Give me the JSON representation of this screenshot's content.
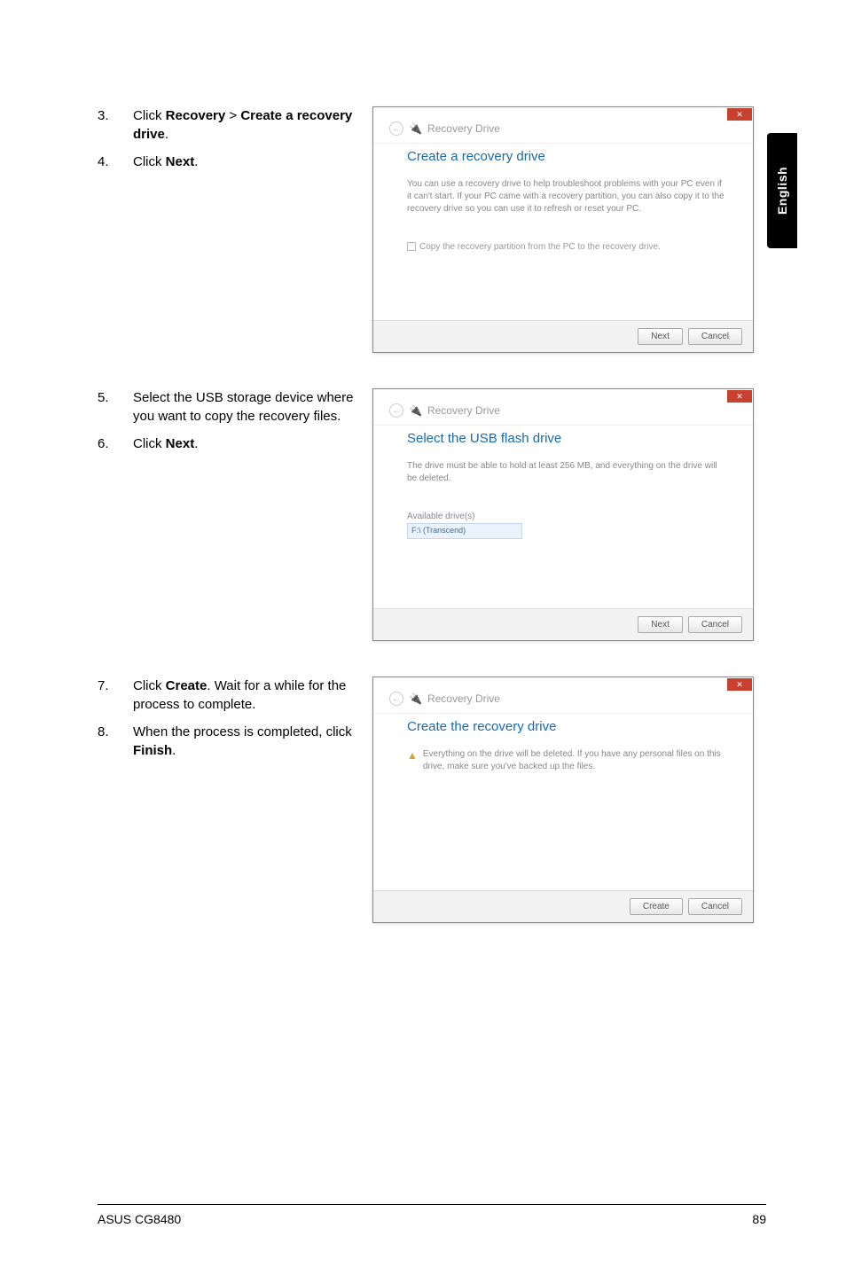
{
  "sideTab": "English",
  "sections": [
    {
      "items": [
        {
          "num": "3.",
          "html": "Click <b>Recovery</b> > <b>Create a recovery drive</b>."
        },
        {
          "num": "4.",
          "html": "Click <b>Next</b>."
        }
      ],
      "dialog": {
        "crumbIcon": "usb-icon",
        "crumbText": "Recovery Drive",
        "title": "Create a recovery drive",
        "desc": "You can use a recovery drive to help troubleshoot problems with your PC even if it can't start. If your PC came with a recovery partition, you can also copy it to the recovery drive so you can use it to refresh or reset your PC.",
        "checkboxLabel": "Copy the recovery partition from the PC to the recovery drive.",
        "buttons": [
          "Next",
          "Cancel"
        ]
      }
    },
    {
      "items": [
        {
          "num": "5.",
          "html": "Select the USB storage device where you want to copy the recovery files."
        },
        {
          "num": "6.",
          "html": "Click <b>Next</b>."
        }
      ],
      "dialog": {
        "crumbIcon": "usb-icon",
        "crumbText": "Recovery Drive",
        "title": "Select the USB flash drive",
        "desc": "The drive must be able to hold at least 256 MB, and everything on the drive will be deleted.",
        "listLabel": "Available drive(s)",
        "listItem": "F:\\ (Transcend)",
        "buttons": [
          "Next",
          "Cancel"
        ]
      }
    },
    {
      "items": [
        {
          "num": "7.",
          "html": "Click <b>Create</b>. Wait for a while for the process to complete."
        },
        {
          "num": "8.",
          "html": "When the process is completed, click <b>Finish</b>."
        }
      ],
      "dialog": {
        "crumbIcon": "usb-icon",
        "crumbText": "Recovery Drive",
        "title": "Create the recovery drive",
        "warn": "Everything on the drive will be deleted. If you have any personal files on this drive, make sure you've backed up the files.",
        "buttons": [
          "Create",
          "Cancel"
        ]
      }
    }
  ],
  "footer": {
    "left": "ASUS CG8480",
    "right": "89"
  }
}
